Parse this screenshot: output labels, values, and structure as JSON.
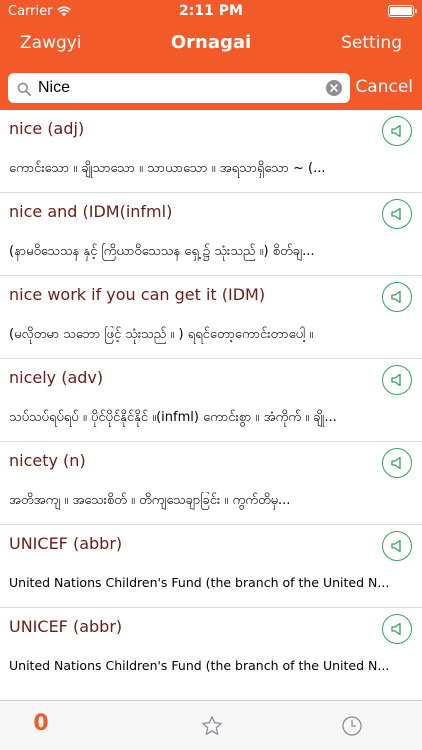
{
  "statusbar": {
    "carrier": "Carrier",
    "time": "2:11 PM",
    "battery_level": 1.0,
    "icons": [
      "wifi-icon",
      "battery-icon"
    ]
  },
  "navbar": {
    "left_label": "Zawgyi",
    "title": "Ornagai",
    "right_label": "Setting"
  },
  "search": {
    "value": "Nice",
    "cancel_label": "Cancel",
    "icons": [
      "search-icon",
      "clear-icon"
    ]
  },
  "results": [
    {
      "headword": "nice (adj)",
      "definition": "ကောင်းသော ။ ချိုသာသော ။ သာယာသော ။ အရသာရှိသော ~ (..."
    },
    {
      "headword": "nice and (IDM(infml)",
      "definition": "(နာမဝိသေသန နှင့် ကြိယာဝိသေသန ရှေ့ ၌ သုံးသည် ။) စိတ်ချ..."
    },
    {
      "headword": "nice work if you can get it (IDM)",
      "definition": "(မလိုတမာ သဘော ဖြင့် သုံးသည် ။ ) ရရင်တော့ကောင်းတာပေါ့ ။"
    },
    {
      "headword": "nicely (adv)",
      "definition": "သပ်သပ်ရပ်ရပ် ။ ပိုင်ပိုင်နိုင်နိုင် ။(infml) ကောင်းစွာ ။ အံကိုက် ။ ချို..."
    },
    {
      "headword": "nicety (n)",
      "definition": "အတိအကျ ။ အသေးစိတ် ။ တိကျသေချာခြင်း ။ ကွက်တိမှ..."
    },
    {
      "headword": "UNICEF (abbr)",
      "definition": "United Nations Children's Fund (the branch of the United N..."
    },
    {
      "headword": "UNICEF (abbr)",
      "definition": "United Nations Children's Fund (the branch of the United N..."
    }
  ],
  "tabbar": {
    "search_tab_label": "0",
    "icons": [
      "star-icon",
      "clock-icon"
    ]
  },
  "colors": {
    "accent": "#f25a2a",
    "headword": "#6b1c14",
    "speaker": "#33a35a"
  }
}
